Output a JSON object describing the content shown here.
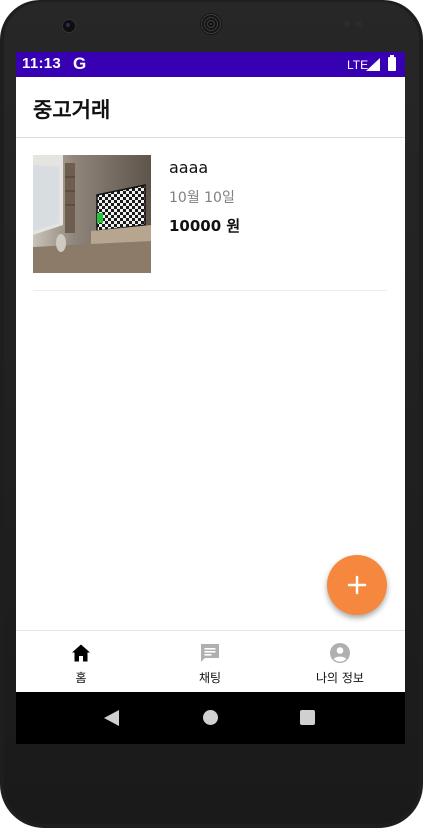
{
  "status_bar": {
    "time": "11:13",
    "carrier_icon": "G",
    "network": "LTE",
    "signal_icon": "signal-icon",
    "battery_icon": "battery-icon"
  },
  "app_bar": {
    "title": "중고거래"
  },
  "listings": [
    {
      "title": "aaaa",
      "date": "10월 10일",
      "price": "10000 원",
      "image_icon": "living-room-tv-photo"
    }
  ],
  "fab": {
    "icon": "plus-icon",
    "color": "#f5883e"
  },
  "bottom_nav": {
    "items": [
      {
        "label": "홈",
        "icon": "home-icon",
        "active": true
      },
      {
        "label": "채팅",
        "icon": "chat-icon",
        "active": false
      },
      {
        "label": "나의 정보",
        "icon": "account-icon",
        "active": false
      }
    ]
  },
  "colors": {
    "status_bar": "#3700b3",
    "accent": "#f5883e",
    "nav_active": "#000000",
    "nav_inactive": "#b0b0b0"
  }
}
